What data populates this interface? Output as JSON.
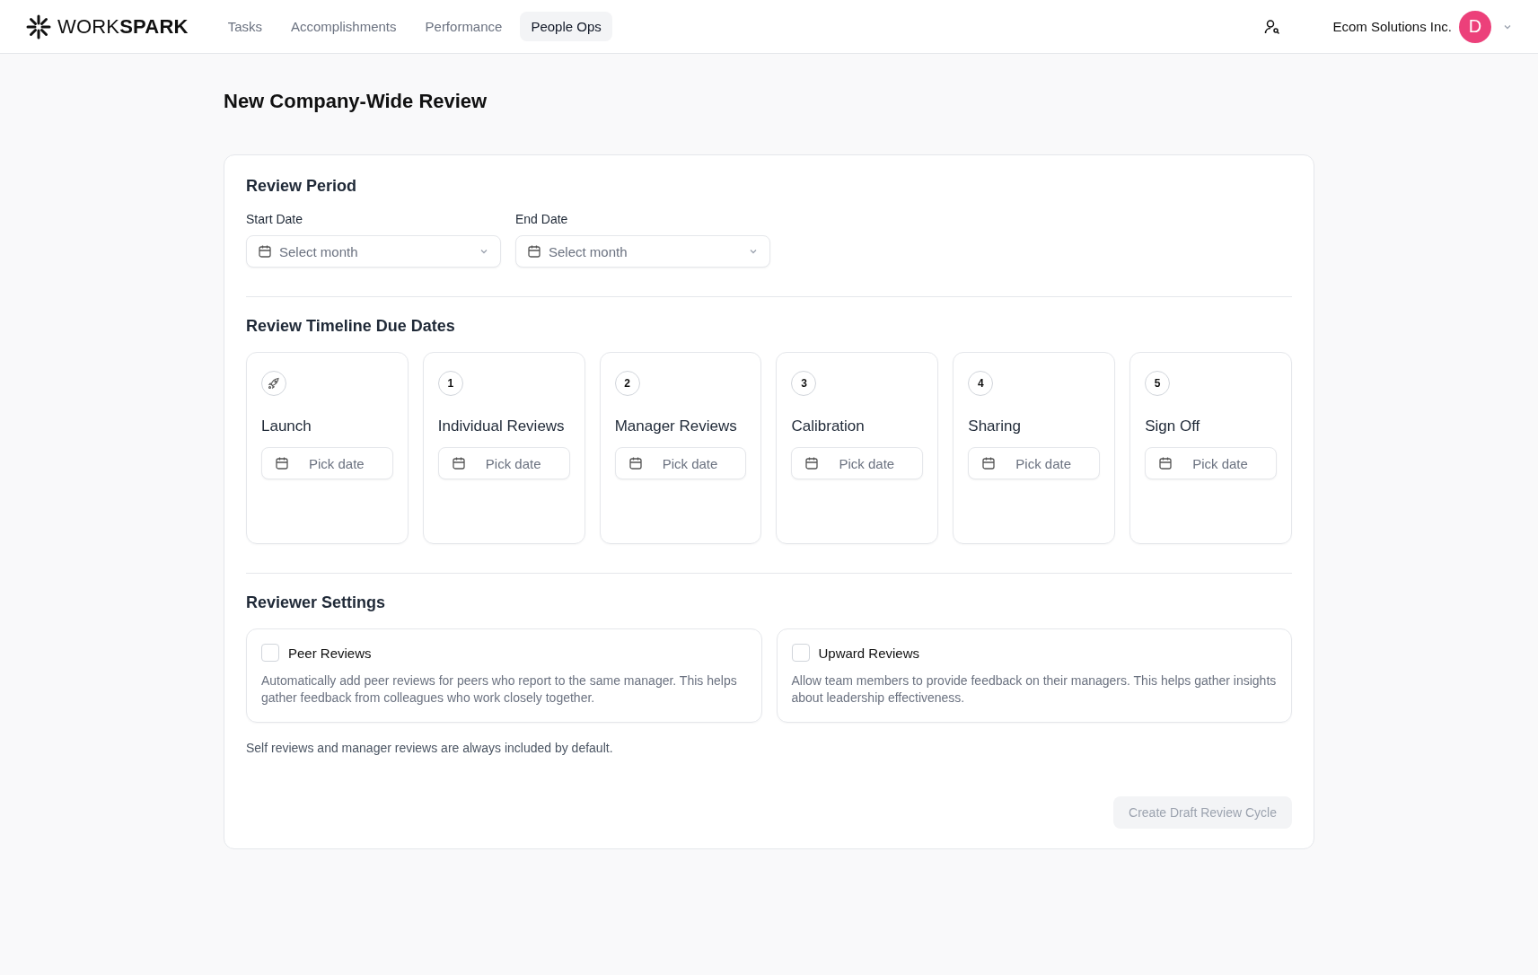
{
  "header": {
    "logo": "WORK**SPARK**",
    "nav": [
      {
        "label": "Tasks",
        "selected": false
      },
      {
        "label": "Accomplishments",
        "selected": false
      },
      {
        "label": "Performance",
        "selected": false
      },
      {
        "label": "People Ops",
        "selected": true
      }
    ],
    "company": "Ecom Solutions Inc.",
    "avatar": "D"
  },
  "title": "New Company-Wide Review",
  "review_period": {
    "heading": "Review Period",
    "fields": [
      {
        "label": "Start Date",
        "placeholder": "Select month"
      },
      {
        "label": "End Date",
        "placeholder": "Select month"
      }
    ]
  },
  "timeline": {
    "heading": "Review Timeline Due Dates",
    "steps": [
      {
        "kind": "launch",
        "name": "Launch",
        "placeholder": "Pick date"
      },
      {
        "kind": "numbered",
        "number": "1",
        "name": "Individual Reviews",
        "placeholder": "Pick date"
      },
      {
        "kind": "numbered",
        "number": "2",
        "name": "Manager Reviews",
        "placeholder": "Pick date"
      },
      {
        "kind": "numbered",
        "number": "3",
        "name": "Calibration",
        "placeholder": "Pick date"
      },
      {
        "kind": "numbered",
        "number": "4",
        "name": "Sharing",
        "placeholder": "Pick date"
      },
      {
        "kind": "numbered",
        "number": "5",
        "name": "Sign Off",
        "placeholder": "Pick date"
      }
    ]
  },
  "reviewer_settings": {
    "heading": "Reviewer Settings",
    "options": [
      {
        "label": "Peer Reviews",
        "checked": false,
        "description": "Automatically add peer reviews for peers who report to the same manager. This helps gather feedback from colleagues who work closely together."
      },
      {
        "label": "Upward Reviews",
        "checked": false,
        "description": "Allow team members to provide feedback on their managers. This helps gather insights about leadership effectiveness."
      }
    ],
    "note": "Self reviews and manager reviews are always included by default."
  },
  "submit": {
    "label": "Create Draft Review Cycle",
    "disabled": true
  }
}
